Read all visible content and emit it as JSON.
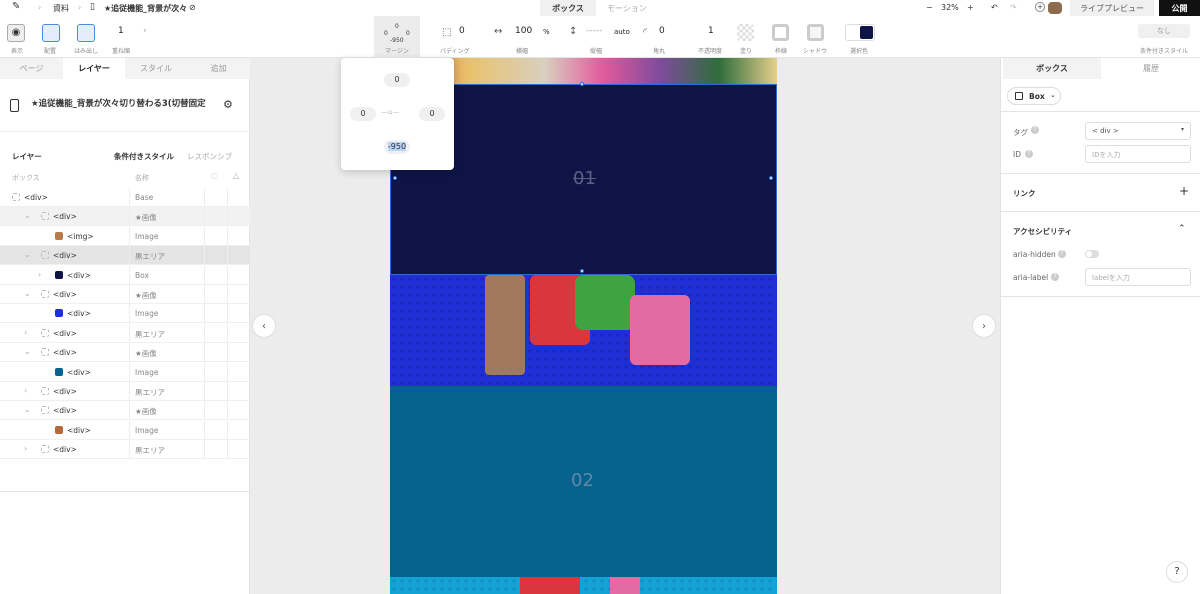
{
  "topbar": {
    "breadcrumb_parent": "資料",
    "page_name": "★追従機能_背景が次々切り替わる3(切替固定",
    "tab_box": "ボックス",
    "tab_motion": "モーション",
    "zoom": "32%",
    "live_preview": "ライブプレビュー",
    "publish": "公開"
  },
  "toolbar": {
    "show_label": "表示",
    "align_label": "配置",
    "overflow_label": "はみ出し",
    "stack_value": "1",
    "stack_label": "重ね順",
    "margin_top": "0",
    "margin_lr": "0",
    "margin_bottom": "-950",
    "margin_label": "マージン",
    "padding_value": "0",
    "padding_label": "パディング",
    "width_value": "100",
    "width_unit": "%",
    "width_label": "横幅",
    "height_value": "-----",
    "height_unit": "auto",
    "height_label": "縦幅",
    "radius_value": "0",
    "radius_label": "角丸",
    "opacity_value": "1",
    "opacity_label": "不透明度",
    "fill_label": "塗り",
    "border_label": "枠線",
    "shadow_label": "シャドウ",
    "selected_color_label": "選択色",
    "cond_style_value": "なし",
    "cond_style_label": "条件付きスタイル",
    "selected_color": "#0e1546"
  },
  "margin_popup": {
    "top": "0",
    "left": "0",
    "right": "0",
    "bottom": "-950"
  },
  "left_panel": {
    "tabs": [
      "ページ",
      "レイヤー",
      "スタイル",
      "追加"
    ],
    "page_title": "★追従機能_背景が次々切り替わる3(切替固定",
    "section_layer": "レイヤー",
    "section_cond": "条件付きスタイル",
    "section_resp": "レスポンシブ",
    "col_box": "ボックス",
    "col_name": "名称",
    "rows": [
      {
        "tag": "<div>",
        "name": "Base"
      },
      {
        "tag": "<div>",
        "name": "★画像"
      },
      {
        "tag": "<img>",
        "name": "Image"
      },
      {
        "tag": "<div>",
        "name": "黒エリア"
      },
      {
        "tag": "<div>",
        "name": "Box"
      },
      {
        "tag": "<div>",
        "name": "★画像"
      },
      {
        "tag": "<div>",
        "name": "Image"
      },
      {
        "tag": "<div>",
        "name": "黒エリア"
      },
      {
        "tag": "<div>",
        "name": "★画像"
      },
      {
        "tag": "<div>",
        "name": "Image"
      },
      {
        "tag": "<div>",
        "name": "黒エリア"
      },
      {
        "tag": "<div>",
        "name": "★画像"
      },
      {
        "tag": "<div>",
        "name": "Image"
      },
      {
        "tag": "<div>",
        "name": "黒エリア"
      }
    ]
  },
  "canvas": {
    "section1_text": "01",
    "section2_text": "02",
    "dark_color": "#0e1546",
    "blue_color": "#1f2fd6",
    "teal_color": "#05628f",
    "cyan_color": "#12a3d4"
  },
  "right_panel": {
    "tab_box": "ボックス",
    "tab_history": "履歴",
    "box_type": "Box",
    "tag_label": "タグ",
    "tag_value": "< div >",
    "id_label": "ID",
    "id_placeholder": "IDを入力",
    "link_label": "リンク",
    "a11y_label": "アクセシビリティ",
    "aria_hidden_label": "aria-hidden",
    "aria_label_label": "aria-label",
    "aria_label_placeholder": "labelを入力",
    "help": "?"
  }
}
